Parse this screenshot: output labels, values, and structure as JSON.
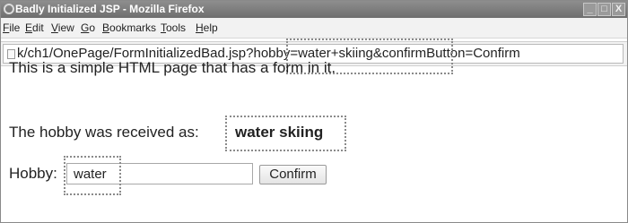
{
  "window": {
    "title": "Badly Initialized JSP - Mozilla Firefox",
    "controls": [
      "_",
      "□",
      "X"
    ]
  },
  "menubar": {
    "items": [
      {
        "first": "F",
        "rest": "ile"
      },
      {
        "first": "E",
        "rest": "dit"
      },
      {
        "first": "V",
        "rest": "iew"
      },
      {
        "first": "G",
        "rest": "o"
      },
      {
        "first": "B",
        "rest": "ookmarks"
      },
      {
        "first": "T",
        "rest": "ools"
      },
      {
        "first": "H",
        "rest": "elp"
      }
    ]
  },
  "urlbar": {
    "url": "k/ch1/OnePage/FormInitializedBad.jsp?hobby=water+skiing&confirmButton=Confirm"
  },
  "page": {
    "intro": "This is a simple HTML page that has a form in it.",
    "received_label": "The hobby was received as:",
    "received_value": "water skiing",
    "hobby_label": "Hobby:",
    "hobby_value": "water",
    "confirm_label": "Confirm"
  }
}
